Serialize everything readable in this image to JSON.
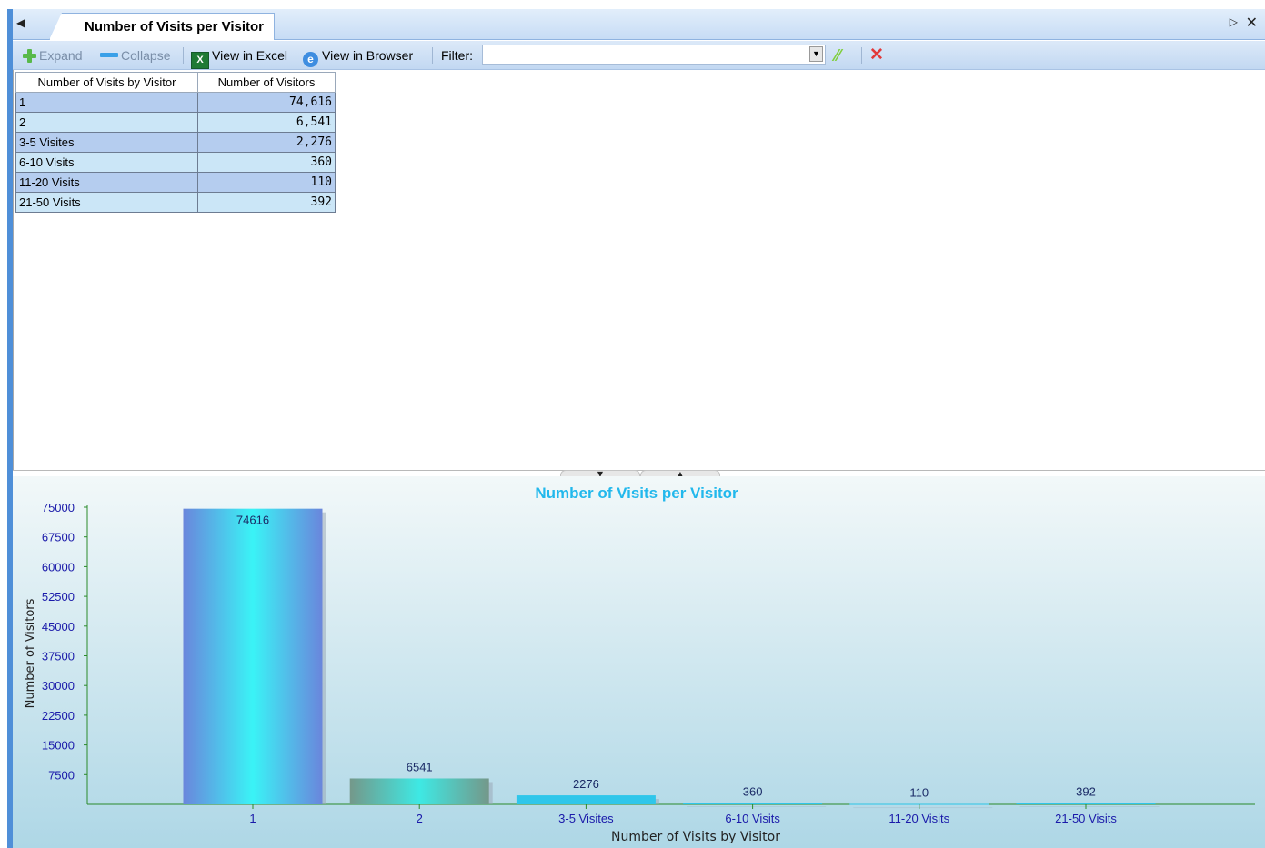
{
  "tabbar": {
    "tab_title": "Number of Visits per Visitor",
    "left_arrow": "◀",
    "right_arrow": "▷",
    "close": "✕"
  },
  "toolbar": {
    "expand": "Expand",
    "collapse": "Collapse",
    "view_in_excel": "View in Excel",
    "view_in_browser": "View in Browser",
    "filter_label": "Filter:",
    "filter_value": ""
  },
  "table": {
    "headers": [
      "Number of Visits by Visitor",
      "Number of Visitors"
    ],
    "rows": [
      {
        "label": "1",
        "value": "74,616"
      },
      {
        "label": "2",
        "value": "6,541"
      },
      {
        "label": "3-5 Visites",
        "value": "2,276"
      },
      {
        "label": "6-10 Visits",
        "value": "360"
      },
      {
        "label": "11-20 Visits",
        "value": "110"
      },
      {
        "label": "21-50 Visits",
        "value": "392"
      }
    ]
  },
  "chart_data": {
    "type": "bar",
    "title": "Number of Visits per Visitor",
    "xlabel": "Number of Visits by Visitor",
    "ylabel": "Number of Visitors",
    "categories": [
      "1",
      "2",
      "3-5 Visites",
      "6-10 Visits",
      "11-20 Visits",
      "21-50 Visits"
    ],
    "values": [
      74616,
      6541,
      2276,
      360,
      110,
      392
    ],
    "data_labels": [
      "74616",
      "6541",
      "2276",
      "360",
      "110",
      "392"
    ],
    "yticks": [
      7500,
      15000,
      22500,
      30000,
      37500,
      45000,
      52500,
      60000,
      67500,
      75000
    ],
    "ylim": [
      0,
      75000
    ],
    "grid": false,
    "legend": "none",
    "colors": {
      "title": "#22b8ec",
      "tick_labels": "#1a1aaa",
      "axis": "#2a8a2a",
      "bar_1_edge": "#6688dd",
      "bar_1_center": "#3af0f4",
      "bar_2_edge": "#6e9a86",
      "bar_2_center": "#3ee8e4",
      "bar_other": "#2fc6ea"
    }
  }
}
